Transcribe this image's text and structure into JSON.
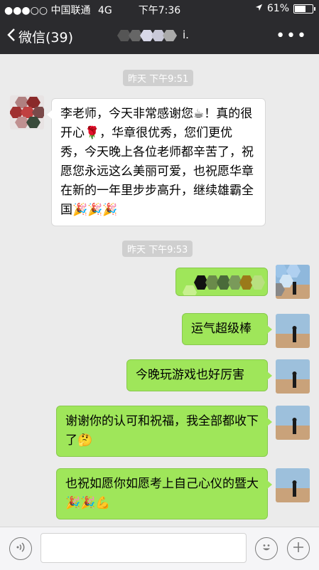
{
  "status_bar": {
    "carrier": "●●●○○ 中国联通",
    "network": "4G",
    "time": "下午7:36",
    "battery": "61%",
    "battery_level": 0.61
  },
  "nav": {
    "back_label": "微信(39)",
    "title_suffix": "i.",
    "more": "•••"
  },
  "messages": [
    {
      "type": "timestamp",
      "text": "昨天 下午9:51"
    },
    {
      "type": "incoming",
      "text": "李老师，今天非常感谢您☕！真的很开心🌹，华章很优秀，您们更优秀，今天晚上各位老师都辛苦了，祝愿您永远这么美丽可爱，也祝愿华章在新的一年里步步高升，继续雄霸全国🎉🎉🎉"
    },
    {
      "type": "timestamp",
      "text": "昨天 下午9:53"
    },
    {
      "type": "outgoing",
      "text": ""
    },
    {
      "type": "outgoing",
      "text": "运气超级棒"
    },
    {
      "type": "outgoing",
      "text": "今晚玩游戏也好厉害"
    },
    {
      "type": "outgoing",
      "text": "谢谢你的认可和祝福，我全部都收下了🤔"
    },
    {
      "type": "outgoing",
      "text": "也祝如愿你如愿考上自己心仪的暨大🎉🎉💪"
    }
  ],
  "colors": {
    "bar_bg": "#2b2b2e",
    "chat_bg": "#ebebeb",
    "outgoing_bubble": "#9fe65a",
    "incoming_bubble": "#ffffff"
  }
}
